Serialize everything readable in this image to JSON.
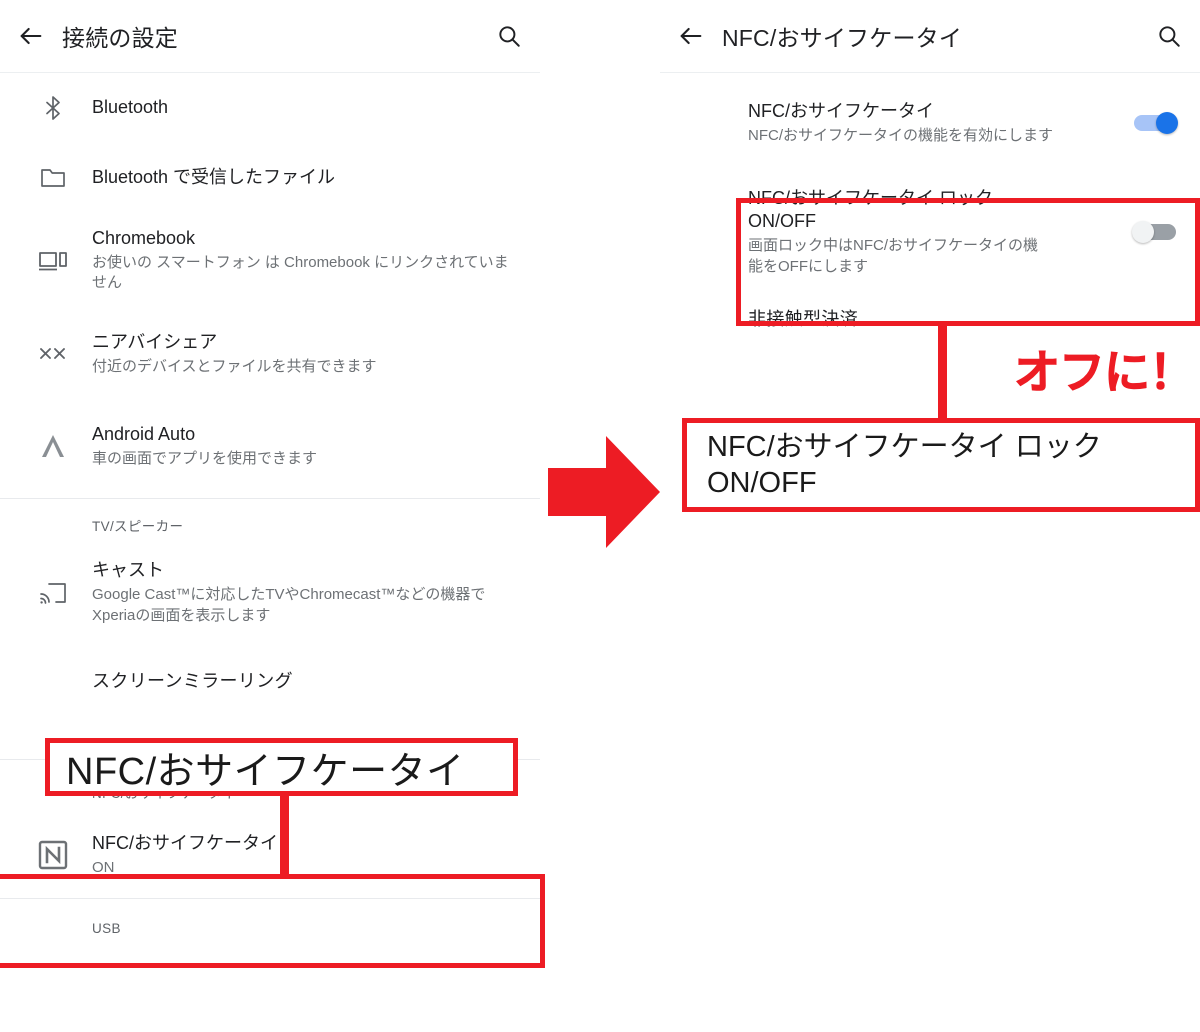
{
  "left_screen": {
    "appbar": {
      "back_icon": "arrow-back-icon",
      "title": "接続の設定",
      "search_icon": "search-icon"
    },
    "rows": [
      {
        "icon": "bluetooth-icon",
        "title": "Bluetooth",
        "subtitle": ""
      },
      {
        "icon": "folder-icon",
        "title": "Bluetooth で受信したファイル",
        "subtitle": ""
      },
      {
        "icon": "chromebook-icon",
        "title": "Chromebook",
        "subtitle": "お使いの スマートフォン は Chromebook にリンクされていません"
      },
      {
        "icon": "nearby-share-icon",
        "title": "ニアバイシェア",
        "subtitle": "付近のデバイスとファイルを共有できます"
      },
      {
        "icon": "android-auto-icon",
        "title": "Android Auto",
        "subtitle": "車の画面でアプリを使用できます"
      }
    ],
    "section_tv": "TV/スピーカー",
    "cast_row": {
      "icon": "cast-icon",
      "title": "キャスト",
      "subtitle": "Google Cast™に対応したTVやChromecast™などの機器でXperiaの画面を表示します"
    },
    "section_mirroring": "スクリーンミラーリング",
    "section_nfc": "NFC/おサイフケータイ",
    "nfc_row": {
      "icon": "nfc-icon",
      "title": "NFC/おサイフケータイ",
      "subtitle": "ON"
    },
    "section_usb": "USB",
    "callout_big": "NFC/おサイフケータイ"
  },
  "right_screen": {
    "appbar": {
      "back_icon": "arrow-back-icon",
      "title": "NFC/おサイフケータイ",
      "search_icon": "search-icon"
    },
    "nfc_main": {
      "title": "NFC/おサイフケータイ",
      "subtitle": "NFC/おサイフケータイの機能を有効にします",
      "toggle_state": "on"
    },
    "nfc_lock": {
      "title": "NFC/おサイフケータイ ロック ON/OFF",
      "subtitle": "画面ロック中はNFC/おサイフケータイの機能をOFFにします",
      "toggle_state": "off"
    },
    "section_payment": "非接触型決済",
    "callout_lock": "NFC/おサイフケータイ ロック ON/OFF",
    "shout": "オフに！"
  },
  "colors": {
    "annotation_red": "#ED1C24",
    "toggle_on": "#1a73e8",
    "toggle_off_track": "#9aa0a6",
    "title_text": "#202124",
    "subtitle_text": "#6d7175"
  },
  "arrow": {
    "name": "right-arrow",
    "color": "#ED1C24"
  }
}
